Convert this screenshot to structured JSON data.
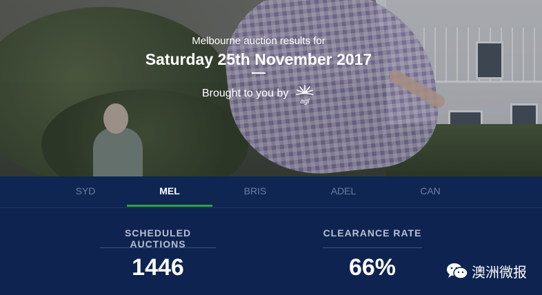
{
  "hero": {
    "subtitle": "Melbourne auction results for",
    "date": "Saturday 25th November 2017",
    "sponsor_text": "Brought to you by",
    "sponsor_logo": "agl"
  },
  "tabs": [
    {
      "label": "SYD",
      "active": false
    },
    {
      "label": "MEL",
      "active": true
    },
    {
      "label": "BRIS",
      "active": false
    },
    {
      "label": "ADEL",
      "active": false
    },
    {
      "label": "CAN",
      "active": false
    }
  ],
  "stats": [
    {
      "label": "SCHEDULED AUCTIONS",
      "value": "1446"
    },
    {
      "label": "CLEARANCE RATE",
      "value": "66%"
    }
  ],
  "watermark": {
    "icon": "wechat-icon",
    "text": "澳洲微报"
  },
  "colors": {
    "accent": "#2fa53a",
    "background": "#0e2350",
    "tab_inactive": "#6f7f9e"
  }
}
